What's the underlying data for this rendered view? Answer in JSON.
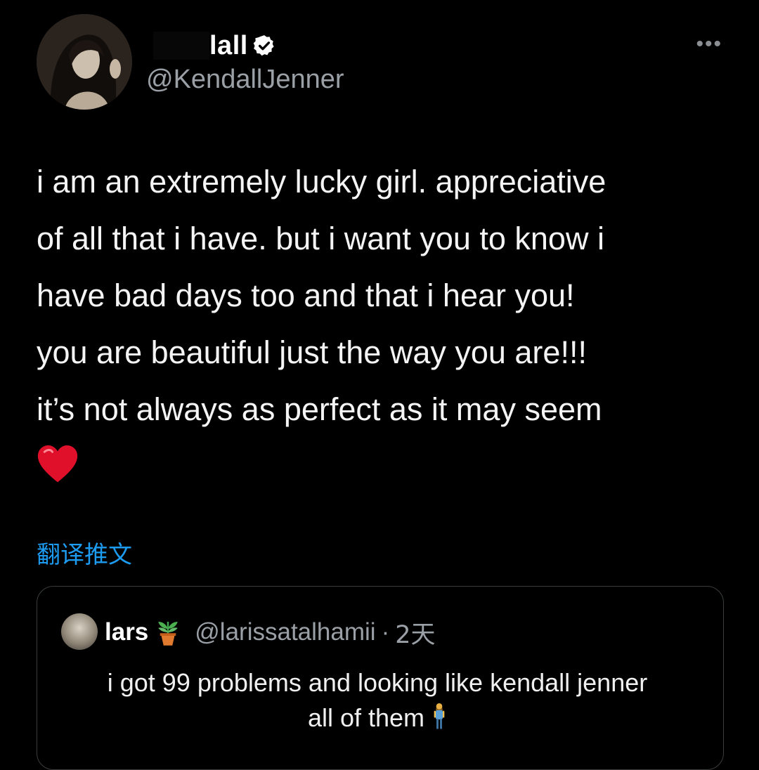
{
  "author": {
    "display_name": "lall",
    "handle": "@KendallJenner"
  },
  "more_label": "•••",
  "tweet": {
    "text": "i am an extremely lucky girl. appreciative\nof all that i have. but i want you to know i\nhave bad days too and that i hear you!\nyou are beautiful just the way you are!!!\nit’s not always as perfect as it may seem"
  },
  "translate_label": "翻译推文",
  "quoted": {
    "name": "lars",
    "handle": "@larissatalhamii",
    "separator": "·",
    "time": "2天",
    "text_line1": "i got 99 problems and looking like kendall jenner",
    "text_line2": "all of them"
  },
  "colors": {
    "background": "#000000",
    "link": "#1d9bf0",
    "muted": "#9aa0a6",
    "heart": "#e0102b"
  }
}
